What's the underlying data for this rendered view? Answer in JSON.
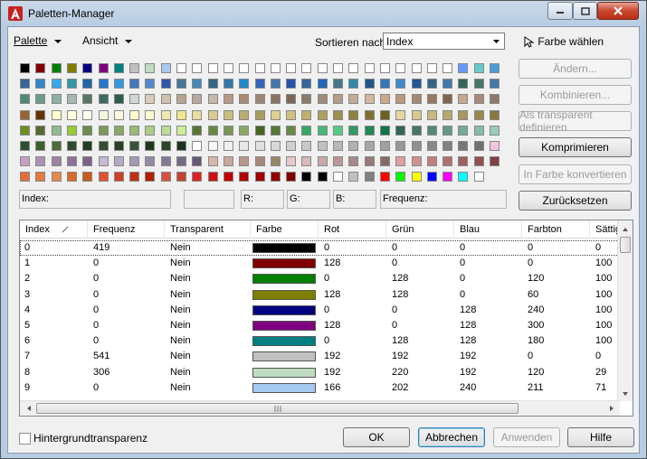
{
  "window": {
    "title": "Paletten-Manager"
  },
  "menus": [
    {
      "label": "Palette",
      "u": "P"
    },
    {
      "label": "Ansicht",
      "u": "A"
    }
  ],
  "sort": {
    "label": "Sortieren nach:",
    "value": "Index"
  },
  "pick_color_label": "Farbe wählen",
  "palette_rows": [
    [
      "#000000",
      "#800000",
      "#008000",
      "#808000",
      "#000080",
      "#800080",
      "#008080",
      "#c0c0c0",
      "#c0dcc0",
      "#a6caf0",
      "#ffffff",
      "#ffffff",
      "#ffffff",
      "#ffffff",
      "#ffffff",
      "#ffffff",
      "#ffffff",
      "#ffffff",
      "#ffffff",
      "#ffffff",
      "#ffffff",
      "#ffffff",
      "#ffffff",
      "#ffffff",
      "#ffffff",
      "#ffffff",
      "#ffffff",
      "#ffffff",
      "#6699ff",
      "#66cccc",
      "#4b9bd6"
    ],
    [
      "#336699",
      "#3388cc",
      "#33aaee",
      "#3399aa",
      "#2266aa",
      "#2277cc",
      "#3399dd",
      "#4477bb",
      "#5588cc",
      "#3355aa",
      "#447799",
      "#4488bb",
      "#336688",
      "#3377aa",
      "#2288cc",
      "#3366bb",
      "#4477aa",
      "#2255aa",
      "#336699",
      "#2266bb",
      "#447788",
      "#3388aa",
      "#225588",
      "#3377bb",
      "#4488cc",
      "#225599",
      "#336688",
      "#4477aa",
      "#336655",
      "#447766",
      "#4477aa"
    ],
    [
      "#4e8a78",
      "#6a9c8a",
      "#8fb0a8",
      "#a5b9b3",
      "#557766",
      "#3e6a60",
      "#2f5a4e",
      "#cfd8d4",
      "#d9ccb8",
      "#cfc1ad",
      "#b9a58f",
      "#bca89a",
      "#c9b8a7",
      "#b89a86",
      "#a88b73",
      "#9e8571",
      "#8a7262",
      "#7b6656",
      "#8c7a6a",
      "#a08c78",
      "#b39c88",
      "#c4ad96",
      "#d2b99f",
      "#caa98a",
      "#b9987c",
      "#a7886e",
      "#96775f",
      "#846650",
      "#c8a78c",
      "#a78a78",
      "#8e7a6c"
    ],
    [
      "#996633",
      "#663300",
      "#ffffcc",
      "#ffffe0",
      "#fffff0",
      "#f5f5dc",
      "#fff8dc",
      "#fffacd",
      "#fafad2",
      "#eee8aa",
      "#f0e68c",
      "#e8dca0",
      "#d8cc90",
      "#c8bc80",
      "#b8ac70",
      "#a89c60",
      "#e0d090",
      "#d0c080",
      "#c0b070",
      "#b0a060",
      "#a09050",
      "#908040",
      "#807030",
      "#706020",
      "#e8d8a0",
      "#d8c890",
      "#c8b880",
      "#b8a870",
      "#a89860",
      "#988850",
      "#887840"
    ],
    [
      "#6b8e23",
      "#556b2f",
      "#8fbc8f",
      "#9acd32",
      "#6b8e4e",
      "#7a9a5a",
      "#88aa66",
      "#99bb77",
      "#aacc88",
      "#bbdd99",
      "#ccee99",
      "#557733",
      "#668844",
      "#779955",
      "#88aa66",
      "#446622",
      "#557733",
      "#668844",
      "#33aa66",
      "#44bb77",
      "#55cc88",
      "#339966",
      "#228855",
      "#117744",
      "#336655",
      "#447766",
      "#558877",
      "#669988",
      "#77aa99",
      "#88bbaa",
      "#99ccbb"
    ],
    [
      "#2f4f2f",
      "#3b5e2b",
      "#4a6b3a",
      "#2e4a2e",
      "#1f3d1f",
      "#344d34",
      "#274027",
      "#3a523a",
      "#203820",
      "#2c442c",
      "#1e321e",
      "#ffffff",
      "#f8f8f8",
      "#f0f0f0",
      "#e8e8e8",
      "#e0e0e0",
      "#d8d8d8",
      "#d0d0d0",
      "#c8c8c8",
      "#c0c0c0",
      "#b8b8b8",
      "#b0b0b0",
      "#a8a8a8",
      "#a0a0a0",
      "#989898",
      "#909090",
      "#888888",
      "#808080",
      "#787878",
      "#707070",
      "#f4c2e4"
    ],
    [
      "#c7a0c8",
      "#b090b8",
      "#a080a8",
      "#907098",
      "#806088",
      "#c7b8d8",
      "#b7a8c8",
      "#a798b8",
      "#9788a8",
      "#877898",
      "#776888",
      "#675878",
      "#d8b8a8",
      "#c8a898",
      "#b89888",
      "#a88878",
      "#988868",
      "#e8c8c8",
      "#d8b8b8",
      "#c8a8a8",
      "#b89898",
      "#a88888",
      "#987878",
      "#886868",
      "#e0a0a0",
      "#d09090",
      "#c08080",
      "#b07070",
      "#a06060",
      "#905050",
      "#804040"
    ],
    [
      "#e66a3a",
      "#e67a3a",
      "#e68a4a",
      "#d86a2a",
      "#c85a1a",
      "#e05030",
      "#d04020",
      "#c03010",
      "#b02000",
      "#d85040",
      "#c84030",
      "#e02020",
      "#d01010",
      "#c00000",
      "#b00000",
      "#a00000",
      "#900000",
      "#800000",
      "#000000",
      "#000000",
      "#ffffff",
      "#c0c0c0",
      "#808080",
      "#ff0000",
      "#00ff00",
      "#ffff00",
      "#0000ff",
      "#ff00ff",
      "#00ffff",
      "#ffffff"
    ]
  ],
  "info": {
    "index": "Index:",
    "r": "R:",
    "g": "G:",
    "b": "B:",
    "freq": "Frequenz:"
  },
  "side_buttons": [
    {
      "label": "Ändern...",
      "enabled": false
    },
    {
      "label": "Kombinieren...",
      "enabled": false
    },
    {
      "label": "Als transparent definieren",
      "enabled": false
    },
    {
      "label": "Komprimieren",
      "enabled": true
    },
    {
      "label": "In Farbe konvertieren",
      "enabled": false
    },
    {
      "label": "Zurücksetzen",
      "enabled": true
    }
  ],
  "table": {
    "headers": [
      "Index",
      "Frequenz",
      "Transparent",
      "Farbe",
      "Rot",
      "Grün",
      "Blau",
      "Farbton",
      "Sättig"
    ],
    "rows": [
      {
        "index": "0",
        "freq": "419",
        "transp": "Nein",
        "color": "#000000",
        "r": "0",
        "g": "0",
        "b": "0",
        "hue": "0",
        "sat": "0"
      },
      {
        "index": "1",
        "freq": "0",
        "transp": "Nein",
        "color": "#800000",
        "r": "128",
        "g": "0",
        "b": "0",
        "hue": "0",
        "sat": "100"
      },
      {
        "index": "2",
        "freq": "0",
        "transp": "Nein",
        "color": "#008000",
        "r": "0",
        "g": "128",
        "b": "0",
        "hue": "120",
        "sat": "100"
      },
      {
        "index": "3",
        "freq": "0",
        "transp": "Nein",
        "color": "#808000",
        "r": "128",
        "g": "128",
        "b": "0",
        "hue": "60",
        "sat": "100"
      },
      {
        "index": "4",
        "freq": "0",
        "transp": "Nein",
        "color": "#000080",
        "r": "0",
        "g": "0",
        "b": "128",
        "hue": "240",
        "sat": "100"
      },
      {
        "index": "5",
        "freq": "0",
        "transp": "Nein",
        "color": "#800080",
        "r": "128",
        "g": "0",
        "b": "128",
        "hue": "300",
        "sat": "100"
      },
      {
        "index": "6",
        "freq": "0",
        "transp": "Nein",
        "color": "#008080",
        "r": "0",
        "g": "128",
        "b": "128",
        "hue": "180",
        "sat": "100"
      },
      {
        "index": "7",
        "freq": "541",
        "transp": "Nein",
        "color": "#c0c0c0",
        "r": "192",
        "g": "192",
        "b": "192",
        "hue": "0",
        "sat": "0"
      },
      {
        "index": "8",
        "freq": "306",
        "transp": "Nein",
        "color": "#c0dcc0",
        "r": "192",
        "g": "220",
        "b": "192",
        "hue": "120",
        "sat": "29"
      },
      {
        "index": "9",
        "freq": "0",
        "transp": "Nein",
        "color": "#a6caf0",
        "r": "166",
        "g": "202",
        "b": "240",
        "hue": "211",
        "sat": "71"
      }
    ]
  },
  "bg_transparency_label": "Hintergrundtransparenz",
  "bottom_buttons": [
    {
      "label": "OK",
      "enabled": true,
      "default": false
    },
    {
      "label": "Abbrechen",
      "enabled": true,
      "default": true
    },
    {
      "label": "Anwenden",
      "enabled": false,
      "default": false
    },
    {
      "label": "Hilfe",
      "enabled": true,
      "default": false
    }
  ]
}
